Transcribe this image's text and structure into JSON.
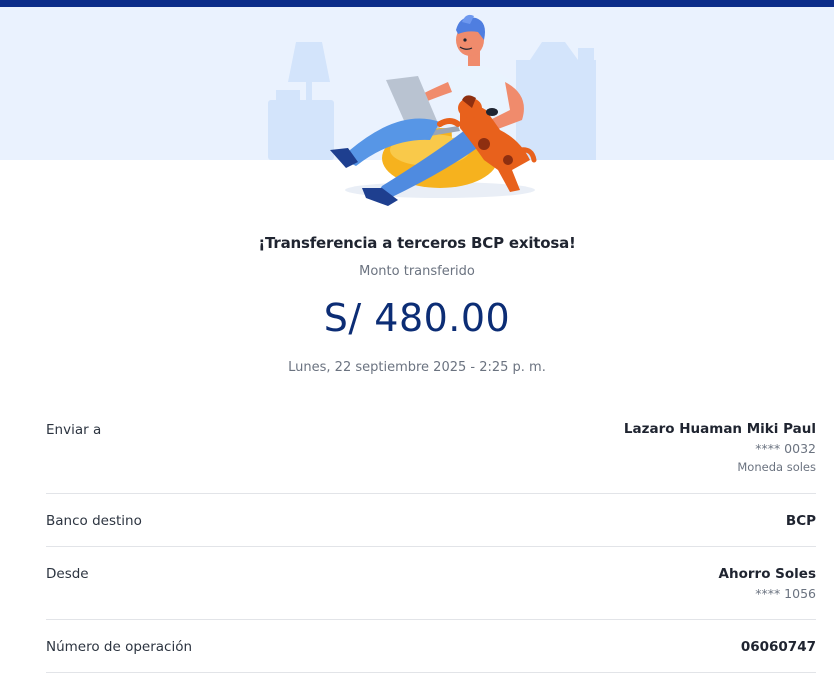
{
  "colors": {
    "top_bar": "#0c2d8a",
    "hero_background": "#eaf2fe",
    "amount": "#0c2d75",
    "divider": "#e2e4e8"
  },
  "receipt": {
    "title": "¡Transferencia a terceros BCP exitosa!",
    "amount_label": "Monto transferido",
    "amount": "S/ 480.00",
    "datetime": "Lunes, 22 septiembre 2025 - 2:25 p. m."
  },
  "details": {
    "recipient": {
      "label": "Enviar a",
      "name": "Lazaro Huaman Miki Paul",
      "account": "**** 0032",
      "currency": "Moneda soles"
    },
    "bank": {
      "label": "Banco destino",
      "value": "BCP"
    },
    "source": {
      "label": "Desde",
      "account_name": "Ahorro Soles",
      "account": "**** 1056"
    },
    "operation": {
      "label": "Número de operación",
      "value": "06060747"
    }
  }
}
